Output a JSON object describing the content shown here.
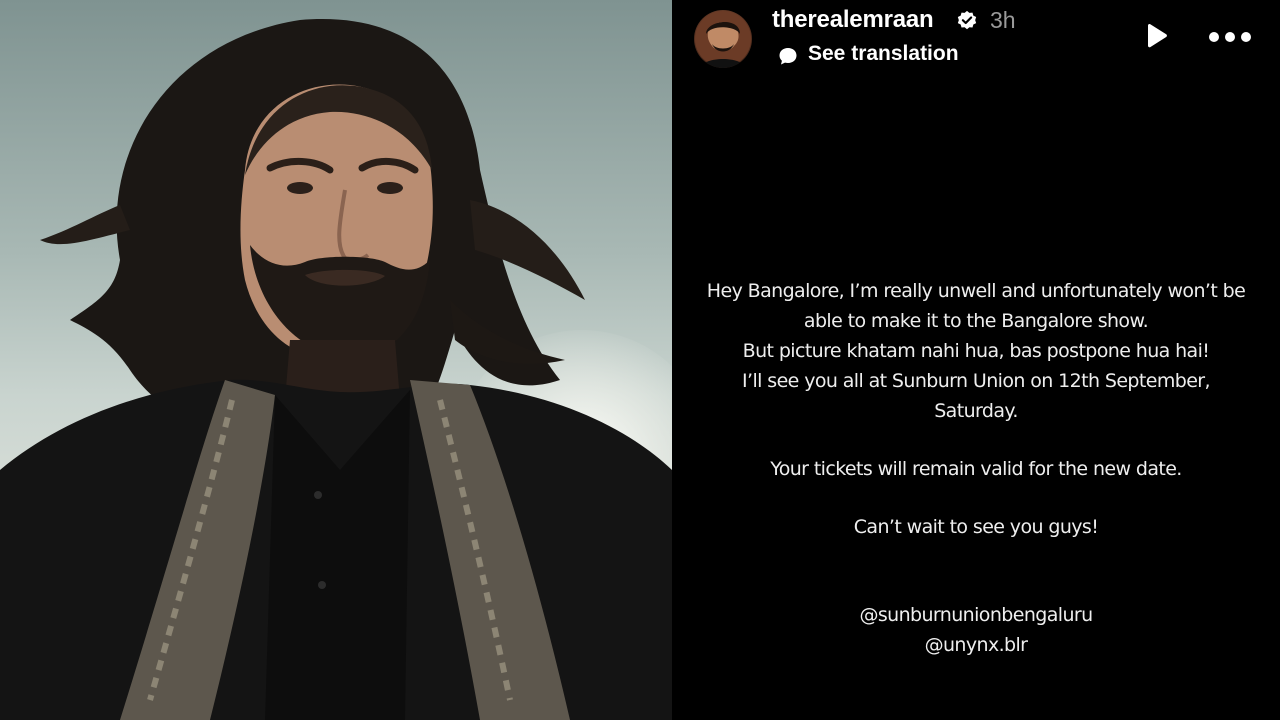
{
  "story": {
    "username": "therealemraan",
    "timestamp": "3h",
    "see_translation": "See translation",
    "message_lines": [
      "Hey Bangalore, I’m really unwell and unfortunately won’t be",
      "able to make it to the Bangalore show.",
      "But picture khatam nahi hua, bas postpone hua hai!",
      "I’ll see you all at Sunburn Union on 12th September,",
      "Saturday."
    ],
    "tickets_line": "Your tickets will remain valid for the new date.",
    "closing_line": "Can’t wait to see you guys!",
    "mentions": [
      "@sunburnunionbengaluru",
      "@unynx.blr"
    ]
  },
  "icons": {
    "verified": "verified-badge-icon",
    "translation": "speech-bubble-icon",
    "play": "play-icon",
    "more": "more-options-icon"
  },
  "colors": {
    "story_background": "#000000",
    "text": "#ffffff",
    "timestamp": "#9a9a9a"
  }
}
